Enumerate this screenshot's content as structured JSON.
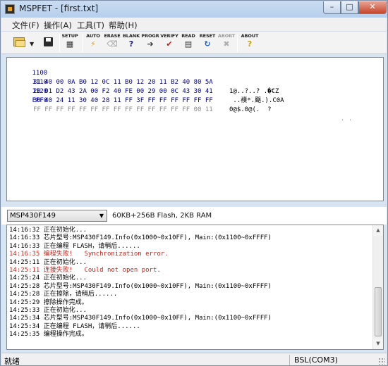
{
  "window": {
    "title": "MSPFET - [first.txt]",
    "controls": {
      "minimize": "–",
      "maximize": "□",
      "close": "✕"
    }
  },
  "menu": {
    "items": [
      "文件(F)",
      "操作(A)",
      "工具(T)",
      "帮助(H)"
    ]
  },
  "toolbar": {
    "buttons": [
      {
        "label": "SETUP",
        "icon": "setup-icon",
        "glyph": "▦",
        "color": "#333333",
        "enabled": true
      },
      {
        "label": "AUTO",
        "icon": "lightning-icon",
        "glyph": "⚡",
        "color": "#e0a800",
        "enabled": true
      },
      {
        "label": "ERASE",
        "icon": "eraser-icon",
        "glyph": "⌫",
        "color": "#a0a0a0",
        "enabled": true
      },
      {
        "label": "BLANK",
        "icon": "blank-check-icon",
        "glyph": "?",
        "color": "#1a1a8a",
        "enabled": true
      },
      {
        "label": "PROGR",
        "icon": "program-icon",
        "glyph": "➔",
        "color": "#333333",
        "enabled": true
      },
      {
        "label": "VERIFY",
        "icon": "checkmark-icon",
        "glyph": "✔",
        "color": "#d01818",
        "enabled": true
      },
      {
        "label": "READ",
        "icon": "read-icon",
        "glyph": "▤",
        "color": "#333333",
        "enabled": true
      },
      {
        "label": "RESET",
        "icon": "reset-icon",
        "glyph": "↻",
        "color": "#2060c0",
        "enabled": true
      },
      {
        "label": "ABORT",
        "icon": "abort-icon",
        "glyph": "✖",
        "color": "#b0b0b0",
        "enabled": false
      },
      {
        "label": "ABOUT",
        "icon": "help-icon",
        "glyph": "?",
        "color": "#c8a000",
        "enabled": true
      }
    ]
  },
  "hex": {
    "rows": [
      {
        "addr": "1100",
        "bytes": "31 40 00 0A B0 12 0C 11 B0 12 20 11 B2 40 80 5A",
        "ascii": "1@..?..? .�€Z",
        "dim": false
      },
      {
        "addr": "1110",
        "bytes": "20 01 D2 43 2A 00 F2 40 FE 00 29 00 0C 43 30 41",
        "ascii": " ..襆*.颶.).C0A",
        "dim": false
      },
      {
        "addr": "1120",
        "bytes": "30 40 24 11 30 40 28 11 FF 3F FF FF FF FF FF FF",
        "ascii": "0@$.0@(.  ?",
        "dim": false
      },
      {
        "addr": "FFF0",
        "bytes": "FF FF FF FF FF FF FF FF FF FF FF FF FF FF 00 11",
        "ascii": "",
        "dim": true,
        "tail": ". ."
      }
    ]
  },
  "device": {
    "selected": "MSP430F149",
    "info": "60KB+256B Flash, 2KB RAM"
  },
  "log": {
    "lines": [
      {
        "text": "14:16:32 正在初始化...",
        "error": false
      },
      {
        "text": "14:16:33 芯片型号:MSP430F149.Info(0x1000~0x10FF), Main:(0x1100~0xFFFF)",
        "error": false
      },
      {
        "text": "14:16:33 正在编程 FLASH，请稍后......",
        "error": false
      },
      {
        "text": "14:16:35 编程失败!   Synchronization error.",
        "error": true
      },
      {
        "text": "14:25:11 正在初始化...",
        "error": false
      },
      {
        "text": "14:25:11 连接失败!   Could not open port.",
        "error": true
      },
      {
        "text": "14:25:24 正在初始化...",
        "error": false
      },
      {
        "text": "14:25:28 芯片型号:MSP430F149.Info(0x1000~0x10FF), Main:(0x1100~0xFFFF)",
        "error": false
      },
      {
        "text": "14:25:28 正在擦除，请稍后......",
        "error": false
      },
      {
        "text": "14:25:29 擦除操作完成。",
        "error": false
      },
      {
        "text": "14:25:33 正在初始化...",
        "error": false
      },
      {
        "text": "14:25:34 芯片型号:MSP430F149.Info(0x1000~0x10FF), Main:(0x1100~0xFFFF)",
        "error": false
      },
      {
        "text": "14:25:34 正在编程 FLASH，请稍后......",
        "error": false
      },
      {
        "text": "14:25:35 编程操作完成。",
        "error": false
      }
    ]
  },
  "status": {
    "left": "就绪",
    "right": "BSL(COM3)"
  }
}
